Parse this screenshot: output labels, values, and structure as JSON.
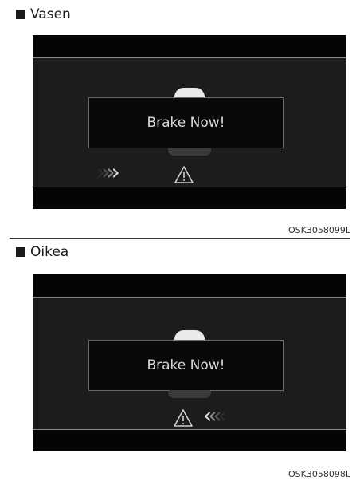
{
  "sections": [
    {
      "heading": "Vasen",
      "alert_text": "Brake Now!",
      "chevron_glyphs": "››››",
      "caption": "OSK3058099L"
    },
    {
      "heading": "Oikea",
      "alert_text": "Brake Now!",
      "chevron_glyphs": "‹‹‹‹",
      "caption": "OSK3058098L"
    }
  ],
  "colors": {
    "panel_background": "#1c1c1c",
    "alert_text": "#d8d8d8",
    "chevron_bright": "#e0e0e0",
    "chevron_dim": "#3a3a3a"
  },
  "icons": [
    "square-bullet-icon",
    "car-icon",
    "warning-triangle-icon",
    "chevron-icon"
  ]
}
